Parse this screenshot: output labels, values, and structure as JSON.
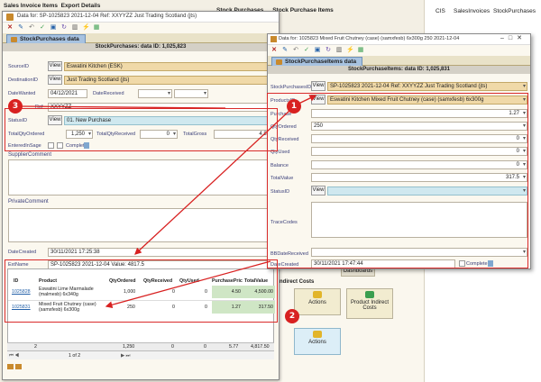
{
  "background": {
    "header_left": "Sales Invoice Items",
    "header_left_sub": "Export Details",
    "menu": [
      "Stock Purchases",
      "Stock Purchase Items"
    ],
    "right_tabs": [
      "CIS",
      "SalesInvoices",
      "StockPurchases"
    ],
    "tiles": [
      {
        "label": "Dashboards"
      },
      {
        "label": "ndirect Costs"
      },
      {
        "label": "Actions"
      },
      {
        "label": "Product Indirect Costs"
      },
      {
        "label": "Actions"
      }
    ]
  },
  "main_window": {
    "title": "Data for: SP-1025823 2021-12-04 Ref: XXYYZZ Just Trading Scotland (jts)",
    "tab_label": "StockPurchases data",
    "header": "StockPurchases: data ID: 1,025,823",
    "view_label": "View",
    "fields": {
      "source_label": "SourceID",
      "source_value": "Eswatini Kitchen (ESK)",
      "destination_label": "DestinationID",
      "destination_value": "Just Trading Scotland (jts)",
      "date_wanted_label": "DateWanted",
      "date_wanted_value": "04/12/2021",
      "date_received_label": "DateReceived",
      "ref_label": "Ref",
      "ref_value": "XXYYZZ",
      "status_label": "StatusID",
      "status_value": "01. New Purchase",
      "total_qty_ordered_label": "TotalQtyOrdered",
      "total_qty_ordered_value": "1,250",
      "total_qty_received_label": "TotalQtyReceived",
      "total_qty_received_value": "0",
      "total_gross_label": "TotalGross",
      "total_gross_value": "4,817.",
      "entered_in_sage_label": "EnteredInSage",
      "complete_label": "Complete",
      "supplier_comment_label": "SupplierComment",
      "private_comment_label": "PrivateComment",
      "date_created_label": "DateCreated",
      "date_created_value": "30/11/2021 17:25:38",
      "ext_name_label": "ExtName",
      "ext_name_value": "SP-1025823 2021-12-04 Value: 4817.5"
    },
    "grid": {
      "columns": [
        "ID",
        "Product",
        "QtyOrdered",
        "QtyReceived",
        "QtyUsed",
        "PurchasePric",
        "TotalValue"
      ],
      "rows": [
        {
          "id": "1025828",
          "product": "Eswatini Lime Marmalade (malmesb) 6x340g",
          "qty_ordered": "1,000",
          "qty_received": "0",
          "qty_used": "0",
          "price": "4.50",
          "total": "4,500.00"
        },
        {
          "id": "1025831",
          "product": "Mixed Fruit Chutney (case) (samxfesb) 6x300g",
          "qty_ordered": "250",
          "qty_received": "0",
          "qty_used": "0",
          "price": "1.27",
          "total": "317.50"
        }
      ],
      "footer": {
        "count": "2",
        "qty_ordered": "1,250",
        "qty_received": "0",
        "qty_used": "0",
        "price": "5.77",
        "total": "4,817.50"
      },
      "pager": "1 of 2"
    }
  },
  "items_window": {
    "title": "Data for: 1025823 Mixed Fruit Chutney (case) (samxfesb) 6x300g 250 2021-12-04",
    "tab_label": "StockPurchaseItems data",
    "header": "StockPurchaseItems: data ID: 1,025,831",
    "view_label": "View",
    "fields": {
      "sp_label": "StockPurchasesID",
      "sp_value": "SP-1025823 2021-12-04 Ref: XXYYZZ Just Trading Scotland (jts)",
      "product_label": "ProductsID",
      "product_value": "Eswatini Kitchen Mixed Fruit Chutney (case) (samxfesb) 6x300g",
      "price_label": "Purchase",
      "price_value": "1.27",
      "qty_ordered_label": "QtyOrdered",
      "qty_ordered_value": "250",
      "qty_received_label": "QtyReceived",
      "qty_received_value": "0",
      "qty_used_label": "QtyUsed",
      "qty_used_value": "0",
      "balance_label": "Balance",
      "balance_value": "0",
      "total_value_label": "TotalValue",
      "total_value_value": "317.5",
      "status_label": "StatusID",
      "trace_codes_label": "TraceCodes",
      "bb_date_label": "BBDateReceived",
      "date_created_label": "DateCreated",
      "date_created_value": "30/11/2021 17:47:44",
      "complete_label": "Complete"
    }
  },
  "annotations": {
    "callout_1": "1",
    "callout_2": "2",
    "callout_3": "3",
    "color": "#d82121"
  }
}
